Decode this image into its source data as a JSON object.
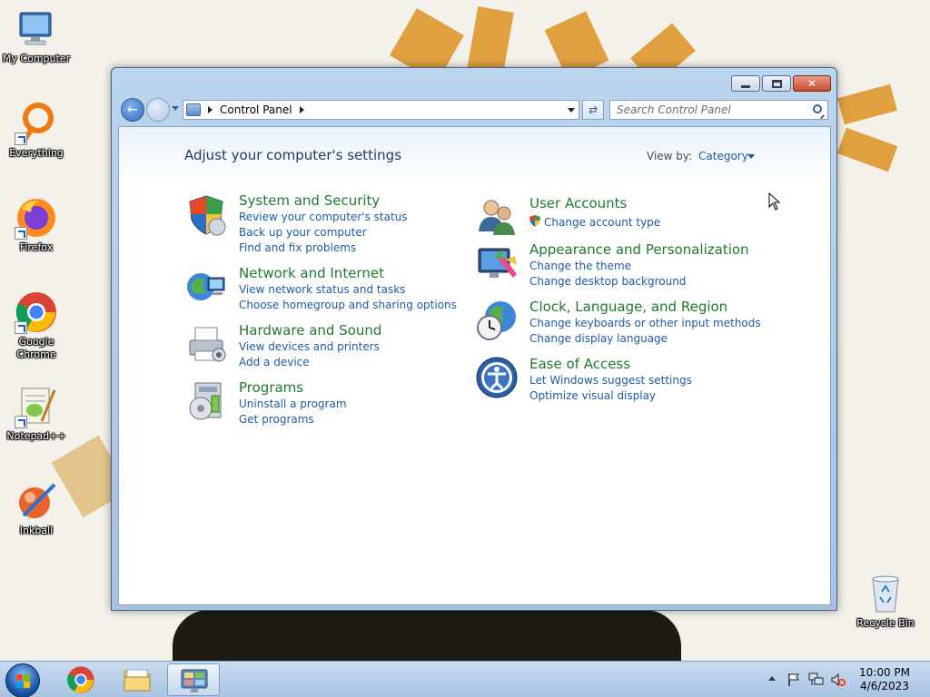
{
  "desktop": {
    "icons": [
      {
        "label": "My Computer"
      },
      {
        "label": "Everything"
      },
      {
        "label": "Firefox"
      },
      {
        "label": "Google Chrome"
      },
      {
        "label": "Notepad++"
      },
      {
        "label": "Inkball"
      },
      {
        "label": "Recycle Bin"
      }
    ]
  },
  "window": {
    "address": {
      "crumb": "Control Panel"
    },
    "search": {
      "placeholder": "Search Control Panel"
    },
    "page_title": "Adjust your computer's settings",
    "view_by": {
      "label": "View by:",
      "value": "Category"
    },
    "categories_left": [
      {
        "title": "System and Security",
        "icon": "shield-icon",
        "links": [
          "Review your computer's status",
          "Back up your computer",
          "Find and fix problems"
        ]
      },
      {
        "title": "Network and Internet",
        "icon": "network-globe-icon",
        "links": [
          "View network status and tasks",
          "Choose homegroup and sharing options"
        ]
      },
      {
        "title": "Hardware and Sound",
        "icon": "printer-icon",
        "links": [
          "View devices and printers",
          "Add a device"
        ]
      },
      {
        "title": "Programs",
        "icon": "programs-icon",
        "links": [
          "Uninstall a program",
          "Get programs"
        ]
      }
    ],
    "categories_right": [
      {
        "title": "User Accounts",
        "icon": "users-icon",
        "links": [
          "Change account type"
        ]
      },
      {
        "title": "Appearance and Personalization",
        "icon": "monitor-paint-icon",
        "links": [
          "Change the theme",
          "Change desktop background"
        ]
      },
      {
        "title": "Clock, Language, and Region",
        "icon": "clock-globe-icon",
        "links": [
          "Change keyboards or other input methods",
          "Change display language"
        ]
      },
      {
        "title": "Ease of Access",
        "icon": "ease-of-access-icon",
        "links": [
          "Let Windows suggest settings",
          "Optimize visual display"
        ]
      }
    ]
  },
  "taskbar": {
    "items": [
      "Start",
      "Google Chrome",
      "Windows Explorer",
      "Control Panel"
    ],
    "clock": {
      "time": "10:00 PM",
      "date": "4/6/2023"
    }
  },
  "colors": {
    "category_title": "#1e7a2c",
    "link": "#1e5aa8",
    "heading": "#1e395b"
  }
}
